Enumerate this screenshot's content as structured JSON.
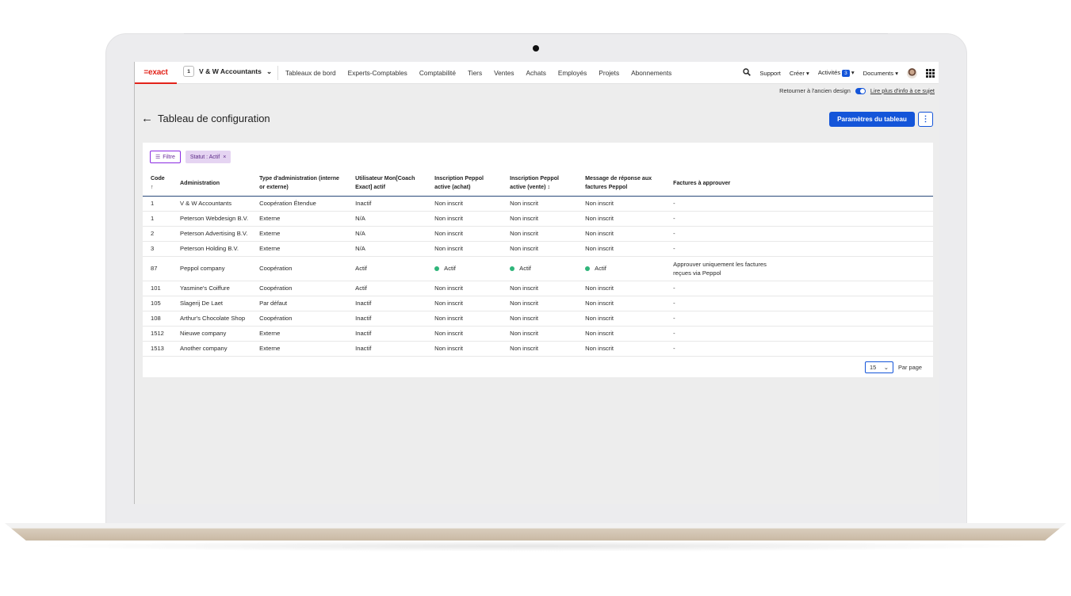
{
  "nav": {
    "logo": "=exact",
    "company_number": "1",
    "company_name": "V & W Accountants",
    "menu": [
      "Tableaux de bord",
      "Experts-Comptables",
      "Comptabilité",
      "Tiers",
      "Ventes",
      "Achats",
      "Employés",
      "Projets",
      "Abonnements"
    ],
    "support": "Support",
    "create": "Créer ▾",
    "activities": "Activités",
    "activities_count": "3",
    "documents": "Documents ▾"
  },
  "subbar": {
    "old_design": "Retourner à l'ancien design",
    "learn_more": "Lire plus d'info à ce sujet"
  },
  "page": {
    "title": "Tableau de configuration",
    "settings_button": "Paramètres du tableau",
    "more": "⋮"
  },
  "filters": {
    "filter_label": "Filtre",
    "chip_label": "Statut : Actif",
    "chip_close": "×"
  },
  "table": {
    "headers": [
      "Code ↑",
      "Administration",
      "Type d'administration (interne or externe)",
      "Utilisateur Mon[Coach Exact] actif",
      "Inscription Peppol active (achat)",
      "Inscription Peppol active (vente) ↕",
      "Message de réponse aux factures Peppol",
      "Factures à approuver"
    ],
    "rows": [
      [
        "1",
        "V & W Accountants",
        "Coopération Étendue",
        "Inactif",
        "Non inscrit",
        "Non inscrit",
        "Non inscrit",
        "-"
      ],
      [
        "1",
        "Peterson Webdesign B.V.",
        "Externe",
        "N/A",
        "Non inscrit",
        "Non inscrit",
        "Non inscrit",
        "-"
      ],
      [
        "2",
        "Peterson Advertising B.V.",
        "Externe",
        "N/A",
        "Non inscrit",
        "Non inscrit",
        "Non inscrit",
        "-"
      ],
      [
        "3",
        "Peterson Holding B.V.",
        "Externe",
        "N/A",
        "Non inscrit",
        "Non inscrit",
        "Non inscrit",
        "-"
      ],
      [
        "87",
        "Peppol company",
        "Coopération",
        "Actif",
        "Actif",
        "Actif",
        "Actif",
        "Approuver uniquement les factures reçues via Peppol"
      ],
      [
        "101",
        "Yasmine's Coiffure",
        "Coopération",
        "Actif",
        "Non inscrit",
        "Non inscrit",
        "Non inscrit",
        "-"
      ],
      [
        "105",
        "Slagerij De Laet",
        "Par défaut",
        "Inactif",
        "Non inscrit",
        "Non inscrit",
        "Non inscrit",
        "-"
      ],
      [
        "108",
        "Arthur's Chocolate Shop",
        "Coopération",
        "Inactif",
        "Non inscrit",
        "Non inscrit",
        "Non inscrit",
        "-"
      ],
      [
        "1512",
        "Nieuwe company",
        "Externe",
        "Inactif",
        "Non inscrit",
        "Non inscrit",
        "Non inscrit",
        "-"
      ],
      [
        "1513",
        "Another company",
        "Externe",
        "Inactif",
        "Non inscrit",
        "Non inscrit",
        "Non inscrit",
        "-"
      ]
    ],
    "status_color_active": "#2fb57a"
  },
  "pager": {
    "page_size": "15",
    "per_page_label": "Par page"
  },
  "colors": {
    "accent": "#1455d9",
    "brand": "#e2231a",
    "filter": "#8a2be2"
  }
}
